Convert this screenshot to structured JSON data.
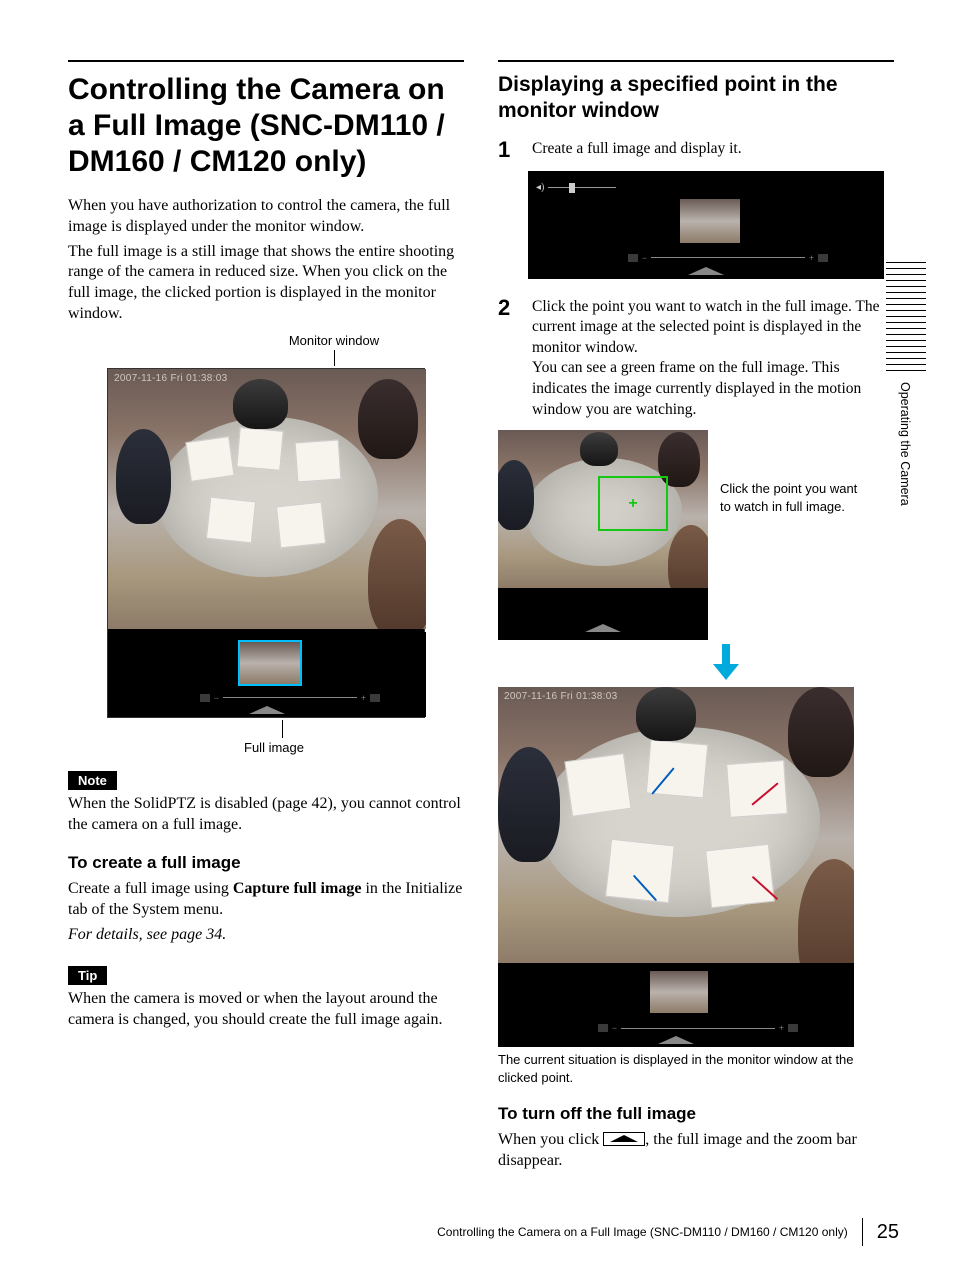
{
  "sideTab": "Operating the Camera",
  "footer": {
    "title": "Controlling the Camera on a Full Image (SNC-DM110 / DM160 / CM120 only)",
    "page": "25"
  },
  "left": {
    "h1": "Controlling the Camera on a Full Image (SNC-DM110 / DM160 / CM120 only)",
    "intro1": "When you have authorization to control the camera, the full image is displayed under the monitor window.",
    "intro2": "The full image is a still image that shows the entire shooting range of the camera in reduced size. When you click on the full image, the clicked portion is displayed in the monitor window.",
    "labelMonitor": "Monitor window",
    "labelFull": "Full image",
    "overlayTimestamp": "2007-11-16 Fri 01:38:03",
    "noteBadge": "Note",
    "noteText": "When the SolidPTZ is disabled (page 42), you cannot control the camera on a full image.",
    "h3Create": "To create a full image",
    "createText1a": "Create a full image using ",
    "createText1b": "Capture full image",
    "createText1c": " in the Initialize tab of the System menu.",
    "createText2": "For details, see page 34.",
    "tipBadge": "Tip",
    "tipText": "When the camera is moved or when the layout around the camera is changed, you should create the full image again."
  },
  "right": {
    "h2": "Displaying a specified point in the monitor window",
    "step1num": "1",
    "step1": "Create a full image and display it.",
    "step2num": "2",
    "step2a": "Click the point you want to watch in the full image. The current image at the selected point is displayed in the monitor window.",
    "step2b": "You can see a green frame on the full image. This indicates the image currently displayed in the motion window you are watching.",
    "figR2caption": "Click the point you want to watch in full image.",
    "figR3caption": "The current situation is displayed in the monitor window at the clicked point.",
    "h3Turnoff": "To turn off the full image",
    "turnoffA": "When you click ",
    "turnoffB": ", the full image and the zoom bar disappear."
  }
}
